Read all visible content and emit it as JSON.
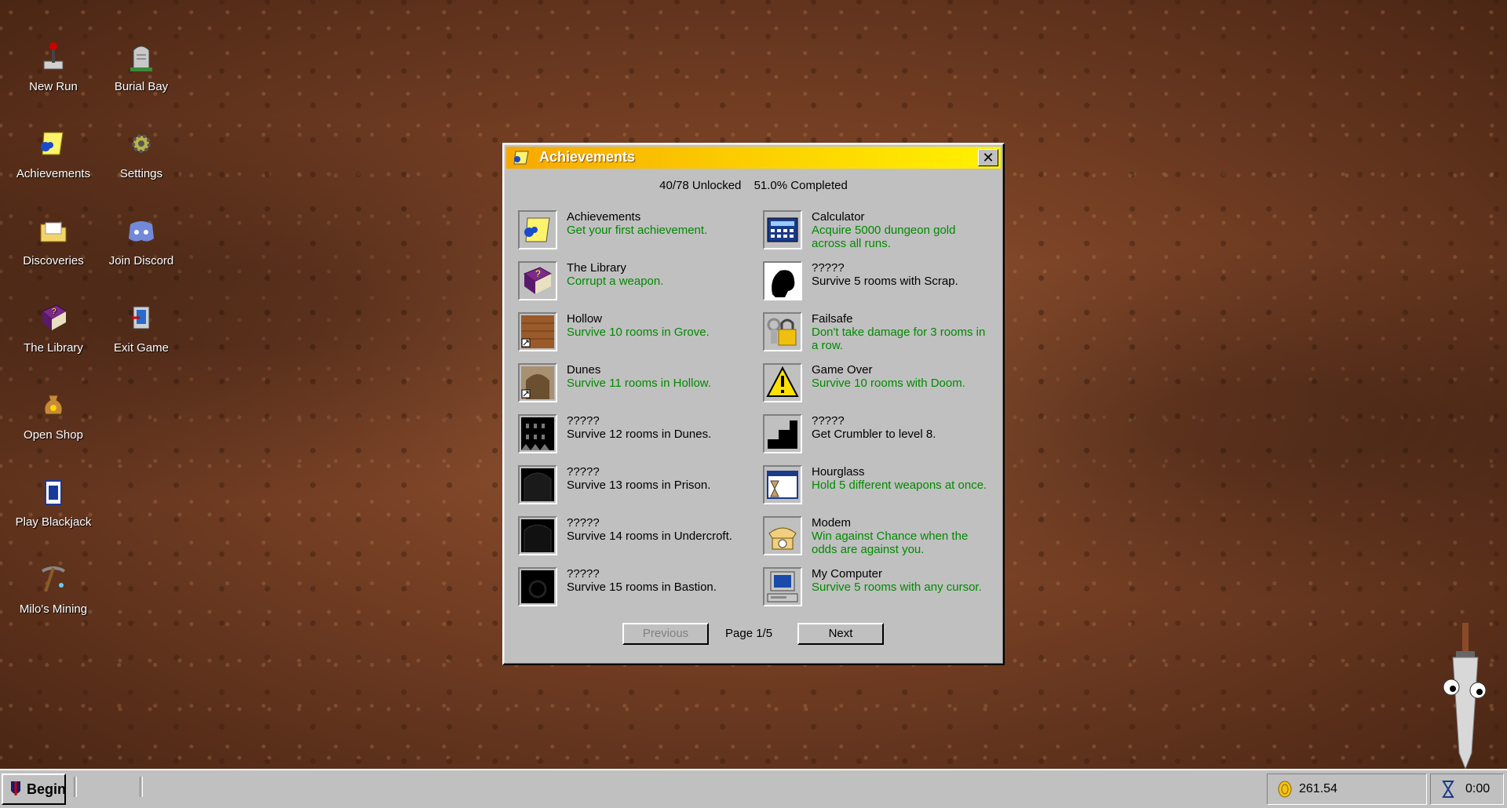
{
  "desktop": {
    "icons": [
      {
        "label": "New Run",
        "icon": "joystick-icon"
      },
      {
        "label": "Burial Bay",
        "icon": "gravestone-icon"
      },
      {
        "label": "Achievements",
        "icon": "achievements-icon"
      },
      {
        "label": "Settings",
        "icon": "gear-icon"
      },
      {
        "label": "Discoveries",
        "icon": "folder-icon"
      },
      {
        "label": "Join Discord",
        "icon": "discord-icon"
      },
      {
        "label": "The Library",
        "icon": "book-icon"
      },
      {
        "label": "Exit Game",
        "icon": "exit-icon"
      },
      {
        "label": "Open Shop",
        "icon": "coin-bag-icon"
      },
      {
        "label": "Play Blackjack",
        "icon": "cards-icon"
      },
      {
        "label": "Milo's Mining",
        "icon": "pickaxe-icon"
      }
    ]
  },
  "window": {
    "title": "Achievements",
    "unlocked": "40/78 Unlocked",
    "completed": "51.0% Completed",
    "close_label": "✕",
    "achievements": [
      {
        "name": "Achievements",
        "desc": "Get your first achievement.",
        "unlocked": true,
        "icon": "achievements-icon"
      },
      {
        "name": "Calculator",
        "desc": "Acquire 5000 dungeon gold across all runs.",
        "unlocked": true,
        "icon": "calculator-icon"
      },
      {
        "name": "The Library",
        "desc": "Corrupt a weapon.",
        "unlocked": true,
        "icon": "book-icon"
      },
      {
        "name": "?????",
        "desc": "Survive 5 rooms with Scrap.",
        "unlocked": false,
        "icon": "silhouette-icon"
      },
      {
        "name": "Hollow",
        "desc": "Survive 10 rooms in Grove.",
        "unlocked": true,
        "icon": "door-icon"
      },
      {
        "name": "Failsafe",
        "desc": "Don't take damage for 3 rooms in a row.",
        "unlocked": true,
        "icon": "padlock-icon"
      },
      {
        "name": "Dunes",
        "desc": "Survive 11 rooms in Hollow.",
        "unlocked": true,
        "icon": "archway-icon"
      },
      {
        "name": "Game Over",
        "desc": "Survive 10 rooms with Doom.",
        "unlocked": true,
        "icon": "warning-icon"
      },
      {
        "name": "?????",
        "desc": "Survive 12 rooms in Dunes.",
        "unlocked": false,
        "icon": "locked-dunes-icon"
      },
      {
        "name": "?????",
        "desc": "Get Crumbler to level 8.",
        "unlocked": false,
        "icon": "locked-stairs-icon"
      },
      {
        "name": "?????",
        "desc": "Survive 13 rooms in Prison.",
        "unlocked": false,
        "icon": "locked-prison-icon"
      },
      {
        "name": "Hourglass",
        "desc": "Hold 5 different weapons at once.",
        "unlocked": true,
        "icon": "hourglass-icon"
      },
      {
        "name": "?????",
        "desc": "Survive 14 rooms in Undercroft.",
        "unlocked": false,
        "icon": "locked-undercroft-icon"
      },
      {
        "name": "Modem",
        "desc": "Win against Chance when the odds are against you.",
        "unlocked": true,
        "icon": "telephone-icon"
      },
      {
        "name": "?????",
        "desc": "Survive 15 rooms in Bastion.",
        "unlocked": false,
        "icon": "locked-bastion-icon"
      },
      {
        "name": "My Computer",
        "desc": "Survive 5 rooms with any cursor.",
        "unlocked": true,
        "icon": "computer-icon"
      }
    ],
    "previous_label": "Previous",
    "page_label": "Page 1/5",
    "next_label": "Next"
  },
  "taskbar": {
    "begin_label": "Begin",
    "gold": "261.54",
    "time": "0:00"
  },
  "colors": {
    "unlocked_text": "#008a00",
    "title_gradient_start": "#f7a800",
    "title_gradient_end": "#fff200"
  }
}
